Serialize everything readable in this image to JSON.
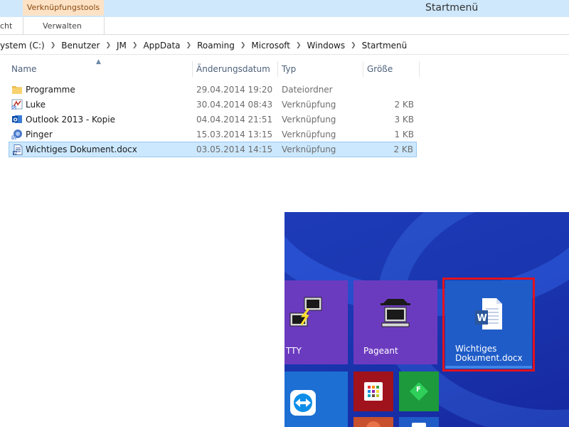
{
  "ribbon": {
    "context_tab": "Verknüpfungstools",
    "window_title": "Startmenü",
    "tabs": [
      "cht",
      "Verwalten"
    ]
  },
  "address": {
    "crumbs": [
      "ystem (C:)",
      "Benutzer",
      "JM",
      "AppData",
      "Roaming",
      "Microsoft",
      "Windows",
      "Startmenü"
    ]
  },
  "columns": {
    "name": "Name",
    "date": "Änderungsdatum",
    "type": "Typ",
    "size": "Größe"
  },
  "files": [
    {
      "name": "Programme",
      "date": "29.04.2014 19:20",
      "type": "Dateiordner",
      "size": "",
      "icon": "folder-icon"
    },
    {
      "name": "Luke",
      "date": "30.04.2014 08:43",
      "type": "Verknüpfung",
      "size": "2 KB",
      "icon": "luke-shortcut-icon"
    },
    {
      "name": "Outlook 2013 - Kopie",
      "date": "04.04.2014 21:51",
      "type": "Verknüpfung",
      "size": "3 KB",
      "icon": "outlook-icon"
    },
    {
      "name": "Pinger",
      "date": "15.03.2014 13:15",
      "type": "Verknüpfung",
      "size": "1 KB",
      "icon": "pinger-icon"
    },
    {
      "name": "Wichtiges Dokument.docx",
      "date": "03.05.2014 14:15",
      "type": "Verknüpfung",
      "size": "2 KB",
      "icon": "word-document-icon",
      "selected": true
    }
  ],
  "start_screen": {
    "tiles": {
      "putty": "TTY",
      "pageant": "Pageant",
      "word_doc_line1": "Wichtiges",
      "word_doc_line2": "Dokument.docx",
      "small_f": "F"
    }
  },
  "colors": {
    "selection": "#cce8ff",
    "context_tab": "#fde2c6",
    "tile_purple": "#6b3bbf",
    "tile_blue": "#1f5cc8",
    "focus_red": "#e0131e"
  }
}
